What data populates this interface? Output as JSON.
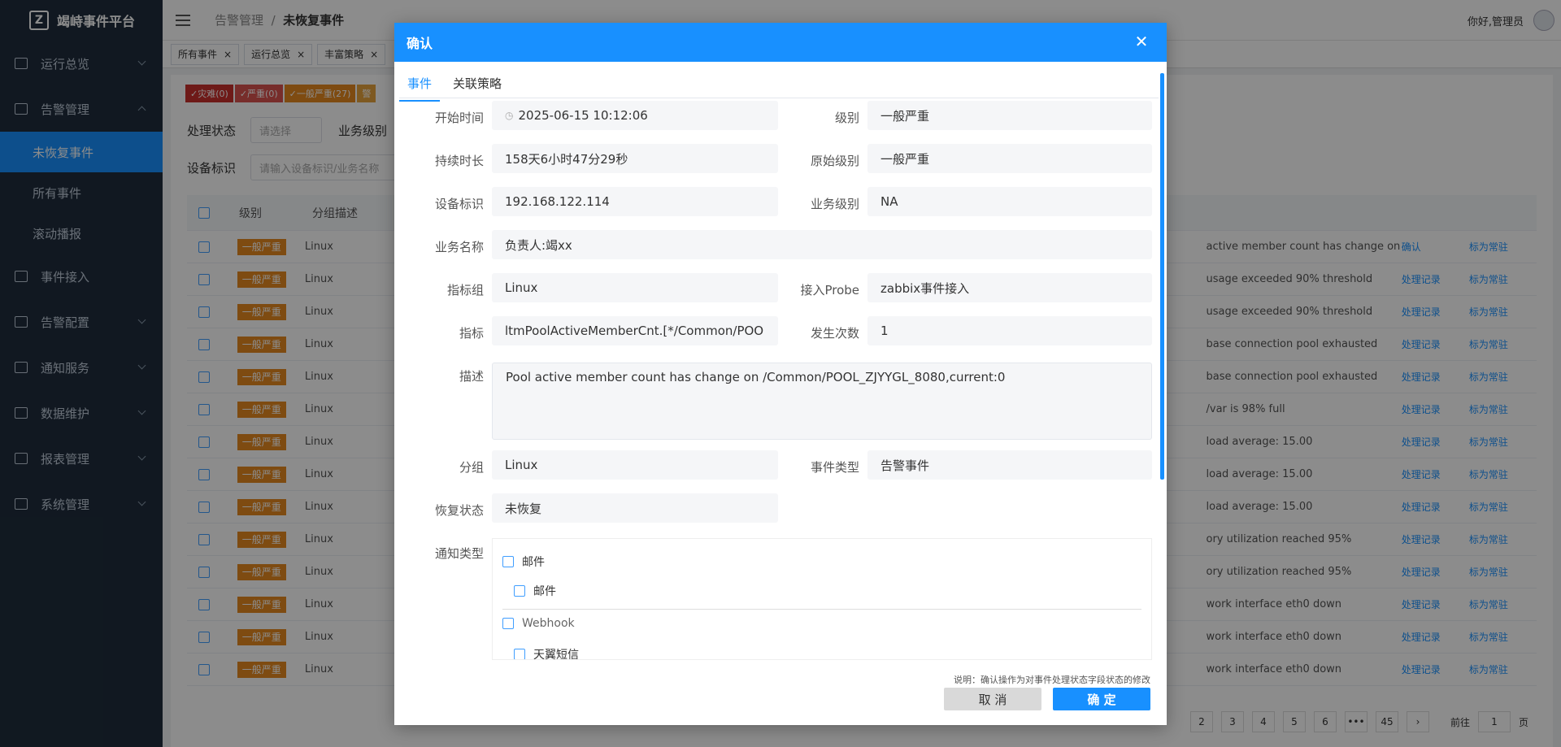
{
  "app": {
    "title": "竭峙事件平台",
    "logo_letter": "Z"
  },
  "sidebar": {
    "items": [
      {
        "label": "运行总览",
        "expanded": false
      },
      {
        "label": "告警管理",
        "expanded": true
      },
      {
        "label": "事件接入",
        "expanded": false
      },
      {
        "label": "告警配置",
        "expanded": false
      },
      {
        "label": "通知服务",
        "expanded": false
      },
      {
        "label": "数据维护",
        "expanded": false
      },
      {
        "label": "报表管理",
        "expanded": false
      },
      {
        "label": "系统管理",
        "expanded": false
      }
    ],
    "subitems": [
      "未恢复事件",
      "所有事件",
      "滚动播报"
    ],
    "active_subitem": "未恢复事件",
    "active_color": "#1890ff"
  },
  "header": {
    "breadcrumb_parent": "告警管理",
    "breadcrumb_sep": "/",
    "breadcrumb_current": "未恢复事件",
    "greeting": "你好,管理员"
  },
  "tagsview": [
    "所有事件",
    "运行总览",
    "丰富策略"
  ],
  "severity_pills": [
    {
      "label": "✓灾难(0)",
      "color": "#c9302c"
    },
    {
      "label": "✓严重(0)",
      "color": "#d9534f"
    },
    {
      "label": "✓一般严重(27)",
      "color": "#e6891f"
    },
    {
      "label": "警",
      "color": "#e6a23c"
    }
  ],
  "filters": {
    "status_label": "处理状态",
    "status_placeholder": "请选择",
    "biz_level_label": "业务级别",
    "device_label": "设备标识",
    "device_placeholder": "请输入设备标识/业务名称"
  },
  "table": {
    "headers": {
      "level": "级别",
      "group_desc": "分组描述"
    },
    "rows": [
      {
        "level": "一般严重",
        "group": "Linux",
        "desc": "active member count has change on",
        "action1": "确认",
        "action2": "标为常驻"
      },
      {
        "level": "一般严重",
        "group": "Linux",
        "desc": "usage exceeded 90% threshold",
        "action1": "处理记录",
        "action2": "标为常驻"
      },
      {
        "level": "一般严重",
        "group": "Linux",
        "desc": "usage exceeded 90% threshold",
        "action1": "处理记录",
        "action2": "标为常驻"
      },
      {
        "level": "一般严重",
        "group": "Linux",
        "desc": "base connection pool exhausted",
        "action1": "处理记录",
        "action2": "标为常驻"
      },
      {
        "level": "一般严重",
        "group": "Linux",
        "desc": "base connection pool exhausted",
        "action1": "处理记录",
        "action2": "标为常驻"
      },
      {
        "level": "一般严重",
        "group": "Linux",
        "desc": "/var is 98% full",
        "action1": "处理记录",
        "action2": "标为常驻"
      },
      {
        "level": "一般严重",
        "group": "Linux",
        "desc": "load average: 15.00",
        "action1": "处理记录",
        "action2": "标为常驻"
      },
      {
        "level": "一般严重",
        "group": "Linux",
        "desc": "load average: 15.00",
        "action1": "处理记录",
        "action2": "标为常驻"
      },
      {
        "level": "一般严重",
        "group": "Linux",
        "desc": "load average: 15.00",
        "action1": "处理记录",
        "action2": "标为常驻"
      },
      {
        "level": "一般严重",
        "group": "Linux",
        "desc": "ory utilization reached 95%",
        "action1": "处理记录",
        "action2": "标为常驻"
      },
      {
        "level": "一般严重",
        "group": "Linux",
        "desc": "ory utilization reached 95%",
        "action1": "处理记录",
        "action2": "标为常驻"
      },
      {
        "level": "一般严重",
        "group": "Linux",
        "desc": "work interface eth0 down",
        "action1": "处理记录",
        "action2": "标为常驻"
      },
      {
        "level": "一般严重",
        "group": "Linux",
        "desc": "work interface eth0 down",
        "action1": "处理记录",
        "action2": "标为常驻"
      },
      {
        "level": "一般严重",
        "group": "Linux",
        "desc": "work interface eth0 down",
        "action1": "处理记录",
        "action2": "标为常驻"
      }
    ]
  },
  "pagination": {
    "pages": [
      "2",
      "3",
      "4",
      "5",
      "6",
      "•••",
      "45"
    ],
    "goto_label": "前往",
    "goto_value": "1",
    "page_unit": "页"
  },
  "modal": {
    "title": "确认",
    "tabs": [
      "事件",
      "关联策略"
    ],
    "fields": {
      "start_time": {
        "label": "开始时间",
        "value": "2025-06-15 10:12:06"
      },
      "level": {
        "label": "级别",
        "value": "一般严重"
      },
      "duration": {
        "label": "持续时长",
        "value": "158天6小时47分29秒"
      },
      "orig_level": {
        "label": "原始级别",
        "value": "一般严重"
      },
      "device": {
        "label": "设备标识",
        "value": "192.168.122.114"
      },
      "biz_level": {
        "label": "业务级别",
        "value": "NA"
      },
      "biz_name": {
        "label": "业务名称",
        "value": "负责人:竭xx"
      },
      "metric_group": {
        "label": "指标组",
        "value": "Linux"
      },
      "probe": {
        "label": "接入Probe",
        "value": "zabbix事件接入"
      },
      "metric": {
        "label": "指标",
        "value": "ltmPoolActiveMemberCnt.[*/Common/POO"
      },
      "count": {
        "label": "发生次数",
        "value": "1"
      },
      "description": {
        "label": "描述",
        "value": "Pool active member count has change on /Common/POOL_ZJYYGL_8080,current:0"
      },
      "group": {
        "label": "分组",
        "value": "Linux"
      },
      "event_type": {
        "label": "事件类型",
        "value": "告警事件"
      },
      "recovery": {
        "label": "恢复状态",
        "value": "未恢复"
      }
    },
    "notify_label": "通知类型",
    "notify_options": [
      {
        "label": "邮件",
        "children": [
          "邮件"
        ]
      },
      {
        "label": "Webhook",
        "children": [
          "天翼短信"
        ]
      }
    ],
    "note": "说明：确认操作为对事件处理状态字段状态的修改",
    "cancel": "取 消",
    "confirm": "确 定"
  }
}
